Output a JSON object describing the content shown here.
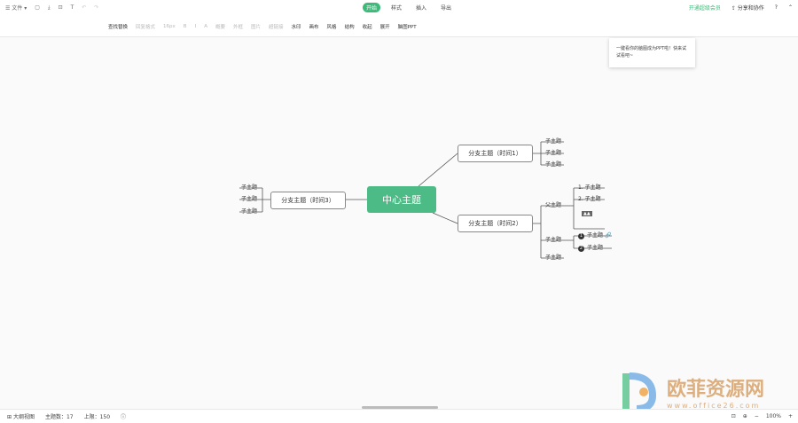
{
  "topbar": {
    "file": "文件",
    "tabs": [
      "开始",
      "样式",
      "插入",
      "导出"
    ],
    "vip": "开通超级会员",
    "share": "分享和协作",
    "help": "?"
  },
  "toolbar": {
    "items": [
      {
        "label": "查找替换",
        "disabled": false
      },
      {
        "label": "回复格式",
        "disabled": true
      },
      {
        "label": "16px",
        "disabled": true
      },
      {
        "label": "B",
        "disabled": true
      },
      {
        "label": "I",
        "disabled": true
      },
      {
        "label": "A",
        "disabled": true
      },
      {
        "label": "概要",
        "disabled": true
      },
      {
        "label": "外框",
        "disabled": true
      },
      {
        "label": "图片",
        "disabled": true
      },
      {
        "label": "超链接",
        "disabled": true
      },
      {
        "label": "水印",
        "disabled": false
      },
      {
        "label": "画布",
        "disabled": false
      },
      {
        "label": "风格",
        "disabled": false
      },
      {
        "label": "结构",
        "disabled": false
      },
      {
        "label": "收起",
        "disabled": false
      },
      {
        "label": "展开",
        "disabled": false
      },
      {
        "label": "脑图PPT",
        "disabled": false
      }
    ]
  },
  "tooltip": "一键看你的脑图成为PPT啦！快来试试看吧~",
  "map": {
    "root": "中心主题",
    "b1": "分支主题（时间1）",
    "b2": "分支主题（时间2）",
    "b3": "分支主题（时间3）",
    "sub": "子主题",
    "parent": "父主题",
    "n1": "1. 子主题",
    "n2": "2. 子主题",
    "badge1": "1",
    "badge2": "2"
  },
  "status": {
    "outline": "大纲视图",
    "count": "主题数：17",
    "limit": "上限：150",
    "zoom": "100%"
  },
  "watermark": {
    "text": "欧菲资源网",
    "url": "www.office26.com"
  }
}
